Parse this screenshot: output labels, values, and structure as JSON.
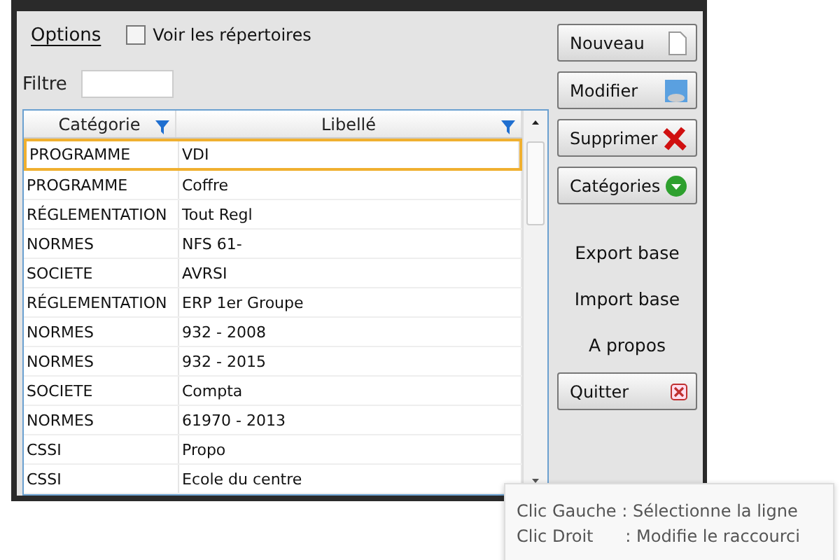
{
  "options": {
    "label": "Options",
    "show_dirs": {
      "label": "Voir les répertoires",
      "checked": false
    }
  },
  "filter": {
    "label": "Filtre"
  },
  "table": {
    "columns": [
      "Catégorie",
      "Libellé"
    ],
    "rows": [
      {
        "category": "PROGRAMME",
        "label": "VDI",
        "selected": true
      },
      {
        "category": "PROGRAMME",
        "label": "Coffre",
        "selected": false
      },
      {
        "category": "RÉGLEMENTATION",
        "label": "Tout Regl",
        "selected": false
      },
      {
        "category": "NORMES",
        "label": "NFS 61-",
        "selected": false
      },
      {
        "category": "SOCIETE",
        "label": "AVRSI",
        "selected": false
      },
      {
        "category": "RÉGLEMENTATION",
        "label": "ERP 1er Groupe",
        "selected": false
      },
      {
        "category": "NORMES",
        "label": "932 - 2008",
        "selected": false
      },
      {
        "category": "NORMES",
        "label": "932 - 2015",
        "selected": false
      },
      {
        "category": "SOCIETE",
        "label": "Compta",
        "selected": false
      },
      {
        "category": "NORMES",
        "label": "61970 - 2013",
        "selected": false
      },
      {
        "category": "CSSI",
        "label": "Propo",
        "selected": false
      },
      {
        "category": "CSSI",
        "label": "Ecole du centre",
        "selected": false
      }
    ]
  },
  "actions": [
    {
      "kind": "button",
      "label": "Nouveau"
    },
    {
      "kind": "button",
      "label": "Modifier"
    },
    {
      "kind": "button",
      "label": "Supprimer"
    },
    {
      "kind": "button",
      "label": "Catégories"
    },
    {
      "kind": "link",
      "label": "Export base"
    },
    {
      "kind": "link",
      "label": "Import base"
    },
    {
      "kind": "link",
      "label": "A propos"
    },
    {
      "kind": "button",
      "label": "Quitter"
    }
  ],
  "tooltip": [
    "Clic Gauche : Sélectionne la ligne",
    "Clic Droit      : Modifie le raccourci"
  ]
}
